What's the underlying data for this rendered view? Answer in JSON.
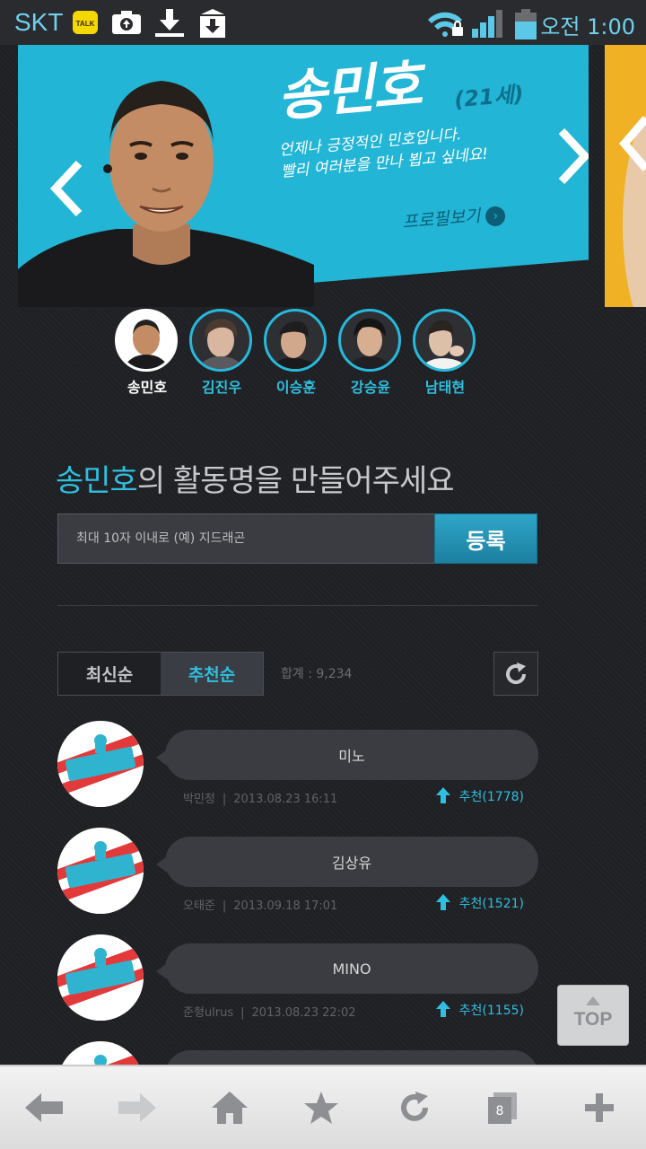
{
  "status_bar": {
    "carrier": "SKT",
    "talk_label": "TALK",
    "time": "오전 1:00",
    "icons": [
      "kakaotalk-icon",
      "camera-upload-icon",
      "download-icon",
      "download-box-icon",
      "wifi-lock-icon",
      "signal-icon",
      "battery-icon"
    ]
  },
  "banner": {
    "name": "송민호",
    "age": "(21세)",
    "desc_line1": "언제나 긍정적인 민호입니다.",
    "desc_line2": "빨리 여러분을 만나 뵙고 싶네요!",
    "profile_link": "프로필보기",
    "colors": {
      "primary": "#22b5d6",
      "next": "#f0b124"
    }
  },
  "members": [
    {
      "name": "송민호",
      "active": true
    },
    {
      "name": "김진우",
      "active": false
    },
    {
      "name": "이승훈",
      "active": false
    },
    {
      "name": "강승윤",
      "active": false
    },
    {
      "name": "남태현",
      "active": false
    }
  ],
  "headline": {
    "name": "송민호",
    "rest": "의 활동명을 만들어주세요"
  },
  "form": {
    "placeholder": "최대 10자 이내로 (예) 지드래곤",
    "submit_label": "등록"
  },
  "sort": {
    "latest": "최신순",
    "recommended": "추천순",
    "active": "recommended",
    "total": "합계 : 9,234"
  },
  "suggestions": [
    {
      "text": "미노",
      "author": "박민정",
      "date": "2013.08.23 16:11",
      "rec": "추천(1778)"
    },
    {
      "text": "김상유",
      "author": "오태준",
      "date": "2013.09.18 17:01",
      "rec": "추천(1521)"
    },
    {
      "text": "MINO",
      "author": "준형ulrus",
      "date": "2013.08.23 22:02",
      "rec": "추천(1155)"
    },
    {
      "text": "",
      "author": "",
      "date": "",
      "rec": ""
    }
  ],
  "top_button": "TOP",
  "browser": {
    "tab_count": "8"
  }
}
